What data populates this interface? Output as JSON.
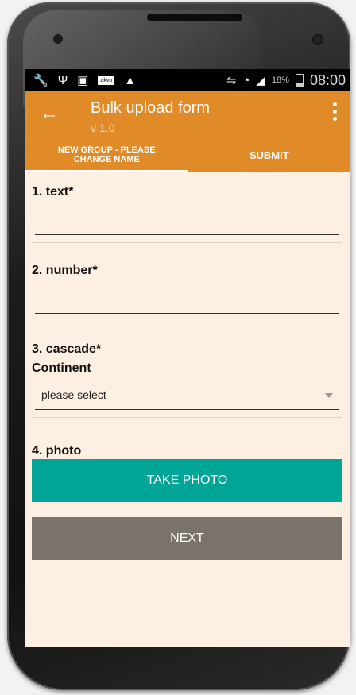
{
  "status_bar": {
    "icons": [
      "wrench-icon",
      "usb-icon",
      "image-icon",
      "akvo-icon",
      "warning-icon"
    ],
    "akvo_label": "akvo",
    "battery_percent": "18%",
    "battery_level": 0.18,
    "time": "08:00"
  },
  "app_bar": {
    "title": "Bulk upload form",
    "subtitle": "v 1.0",
    "accent_color": "#e08a28"
  },
  "tabs": [
    {
      "label": "NEW GROUP - PLEASE CHANGE NAME",
      "selected": true
    },
    {
      "label": "SUBMIT",
      "selected": false
    }
  ],
  "questions": {
    "q1": {
      "label": "1. text*",
      "value": ""
    },
    "q2": {
      "label": "2. number*",
      "value": ""
    },
    "q3": {
      "label": "3. cascade*",
      "sub_label": "Continent",
      "selected": "please select"
    },
    "q4": {
      "label": "4. photo",
      "button": "TAKE PHOTO"
    }
  },
  "next_button": "NEXT",
  "colors": {
    "background": "#fdf0e3",
    "photo_button": "#00a597",
    "next_button": "#7a736c"
  }
}
